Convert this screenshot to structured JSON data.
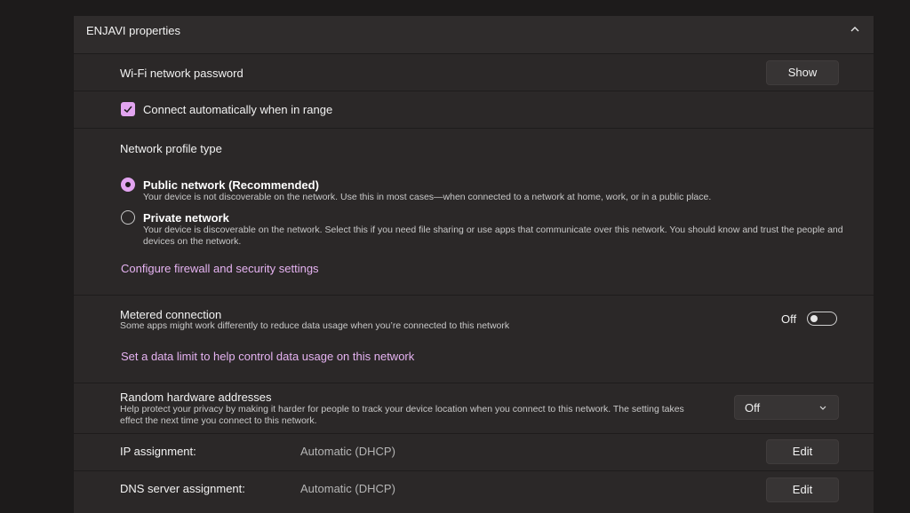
{
  "section": {
    "title": "ENJAVI properties"
  },
  "wifi_password": {
    "label": "Wi-Fi network password",
    "button": "Show"
  },
  "auto_connect": {
    "label": "Connect automatically when in range",
    "checked": true
  },
  "profile": {
    "heading": "Network profile type",
    "options": [
      {
        "label": "Public network (Recommended)",
        "description": "Your device is not discoverable on the network. Use this in most cases—when connected to a network at home, work, or in a public place.",
        "selected": true
      },
      {
        "label": "Private network",
        "description": "Your device is discoverable on the network. Select this if you need file sharing or use apps that communicate over this network. You should know and trust the people and devices on the network.",
        "selected": false
      }
    ],
    "firewall_link": "Configure firewall and security settings"
  },
  "metered": {
    "label": "Metered connection",
    "description": "Some apps might work differently to reduce data usage when you’re connected to this network",
    "toggle_state": "Off",
    "data_limit_link": "Set a data limit to help control data usage on this network"
  },
  "random_hw": {
    "label": "Random hardware addresses",
    "description": "Help protect your privacy by making it harder for people to track your device location when you connect to this network. The setting takes effect the next time you connect to this network.",
    "selected": "Off"
  },
  "ip": {
    "label": "IP assignment:",
    "value": "Automatic (DHCP)",
    "button": "Edit"
  },
  "dns": {
    "label": "DNS server assignment:",
    "value": "Automatic (DHCP)",
    "button": "Edit"
  },
  "colors": {
    "accent": "#e2a4f0",
    "link": "#e6b3f2",
    "panel": "#2b2828",
    "background": "#1d1b1b"
  },
  "icons": {
    "collapse": "chevron-up-icon",
    "check": "checkmark-icon",
    "dropdown": "chevron-down-icon"
  }
}
